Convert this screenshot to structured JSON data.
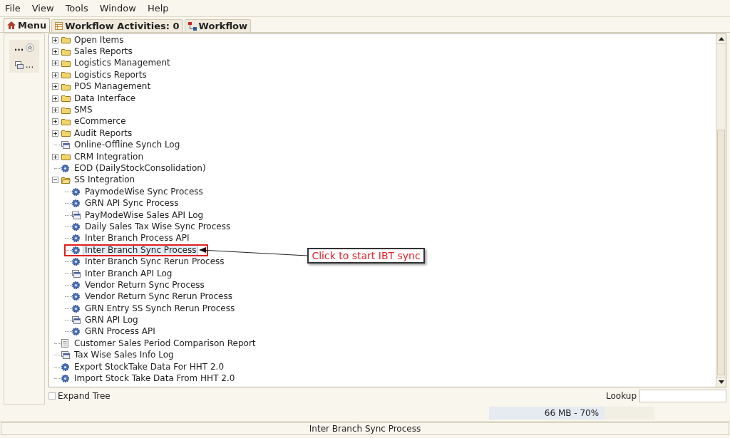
{
  "menu_bar": [
    "File",
    "View",
    "Tools",
    "Window",
    "Help"
  ],
  "tabs": [
    {
      "label": "Menu",
      "selected": true
    },
    {
      "label": "Workflow Activities: 0",
      "selected": false
    },
    {
      "label": "Workflow",
      "selected": false
    }
  ],
  "side_panel": {
    "items": [
      "...",
      "..."
    ]
  },
  "tree": [
    {
      "label": "Open Items",
      "kind": "folder",
      "expanded": false,
      "selected": false
    },
    {
      "label": "Sales Reports",
      "kind": "folder",
      "expanded": false,
      "selected": false
    },
    {
      "label": "Logistics Management",
      "kind": "folder",
      "expanded": false,
      "selected": false
    },
    {
      "label": "Logistics Reports",
      "kind": "folder",
      "expanded": false,
      "selected": false
    },
    {
      "label": "POS Management",
      "kind": "folder",
      "expanded": false,
      "selected": false
    },
    {
      "label": "Data Interface",
      "kind": "folder",
      "expanded": false,
      "selected": false
    },
    {
      "label": "SMS",
      "kind": "folder",
      "expanded": false,
      "selected": false
    },
    {
      "label": "eCommerce",
      "kind": "folder",
      "expanded": false,
      "selected": false
    },
    {
      "label": "Audit Reports",
      "kind": "folder",
      "expanded": false,
      "selected": false
    },
    {
      "label": "Online-Offline Synch Log",
      "kind": "log",
      "selected": false
    },
    {
      "label": "CRM Integration",
      "kind": "folder",
      "expanded": false,
      "selected": false
    },
    {
      "label": "EOD (DailyStockConsolidation)",
      "kind": "process",
      "selected": false
    },
    {
      "label": "SS Integration",
      "kind": "folder",
      "expanded": true,
      "selected": false,
      "children": [
        {
          "label": "PaymodeWise Sync Process",
          "kind": "process",
          "selected": false
        },
        {
          "label": "GRN API Sync Process",
          "kind": "process",
          "selected": false
        },
        {
          "label": "PayModeWise Sales API Log",
          "kind": "log",
          "selected": false
        },
        {
          "label": "Daily Sales Tax Wise Sync Process",
          "kind": "process",
          "selected": false
        },
        {
          "label": "Inter Branch Process API",
          "kind": "process",
          "selected": false
        },
        {
          "label": "Inter Branch Sync Process",
          "kind": "process",
          "selected": true
        },
        {
          "label": "Inter Branch Sync Rerun Process",
          "kind": "process",
          "selected": false
        },
        {
          "label": "Inter Branch API Log",
          "kind": "log",
          "selected": false
        },
        {
          "label": "Vendor Return Sync Process",
          "kind": "process",
          "selected": false
        },
        {
          "label": "Vendor Return Sync Rerun Process",
          "kind": "process",
          "selected": false
        },
        {
          "label": "GRN Entry SS Synch Rerun Process",
          "kind": "process",
          "selected": false
        },
        {
          "label": "GRN API Log",
          "kind": "log",
          "selected": false
        },
        {
          "label": "GRN Process API",
          "kind": "process",
          "selected": false
        }
      ]
    },
    {
      "label": "Customer Sales Period Comparison Report",
      "kind": "report",
      "selected": false
    },
    {
      "label": "Tax Wise Sales Info Log",
      "kind": "log",
      "selected": false
    },
    {
      "label": "Export StockTake Data For HHT 2.0",
      "kind": "process",
      "selected": false
    },
    {
      "label": "Import Stock Take Data From HHT 2.0",
      "kind": "process",
      "selected": false
    }
  ],
  "annotation": {
    "text": "Click to start IBT sync"
  },
  "expand_tree": {
    "label": "Expand Tree",
    "checked": false
  },
  "lookup": {
    "label": "Lookup"
  },
  "memory": {
    "text": "66 MB - 70%",
    "level": 0.7
  },
  "status_bar": "Inter Branch Sync Process"
}
